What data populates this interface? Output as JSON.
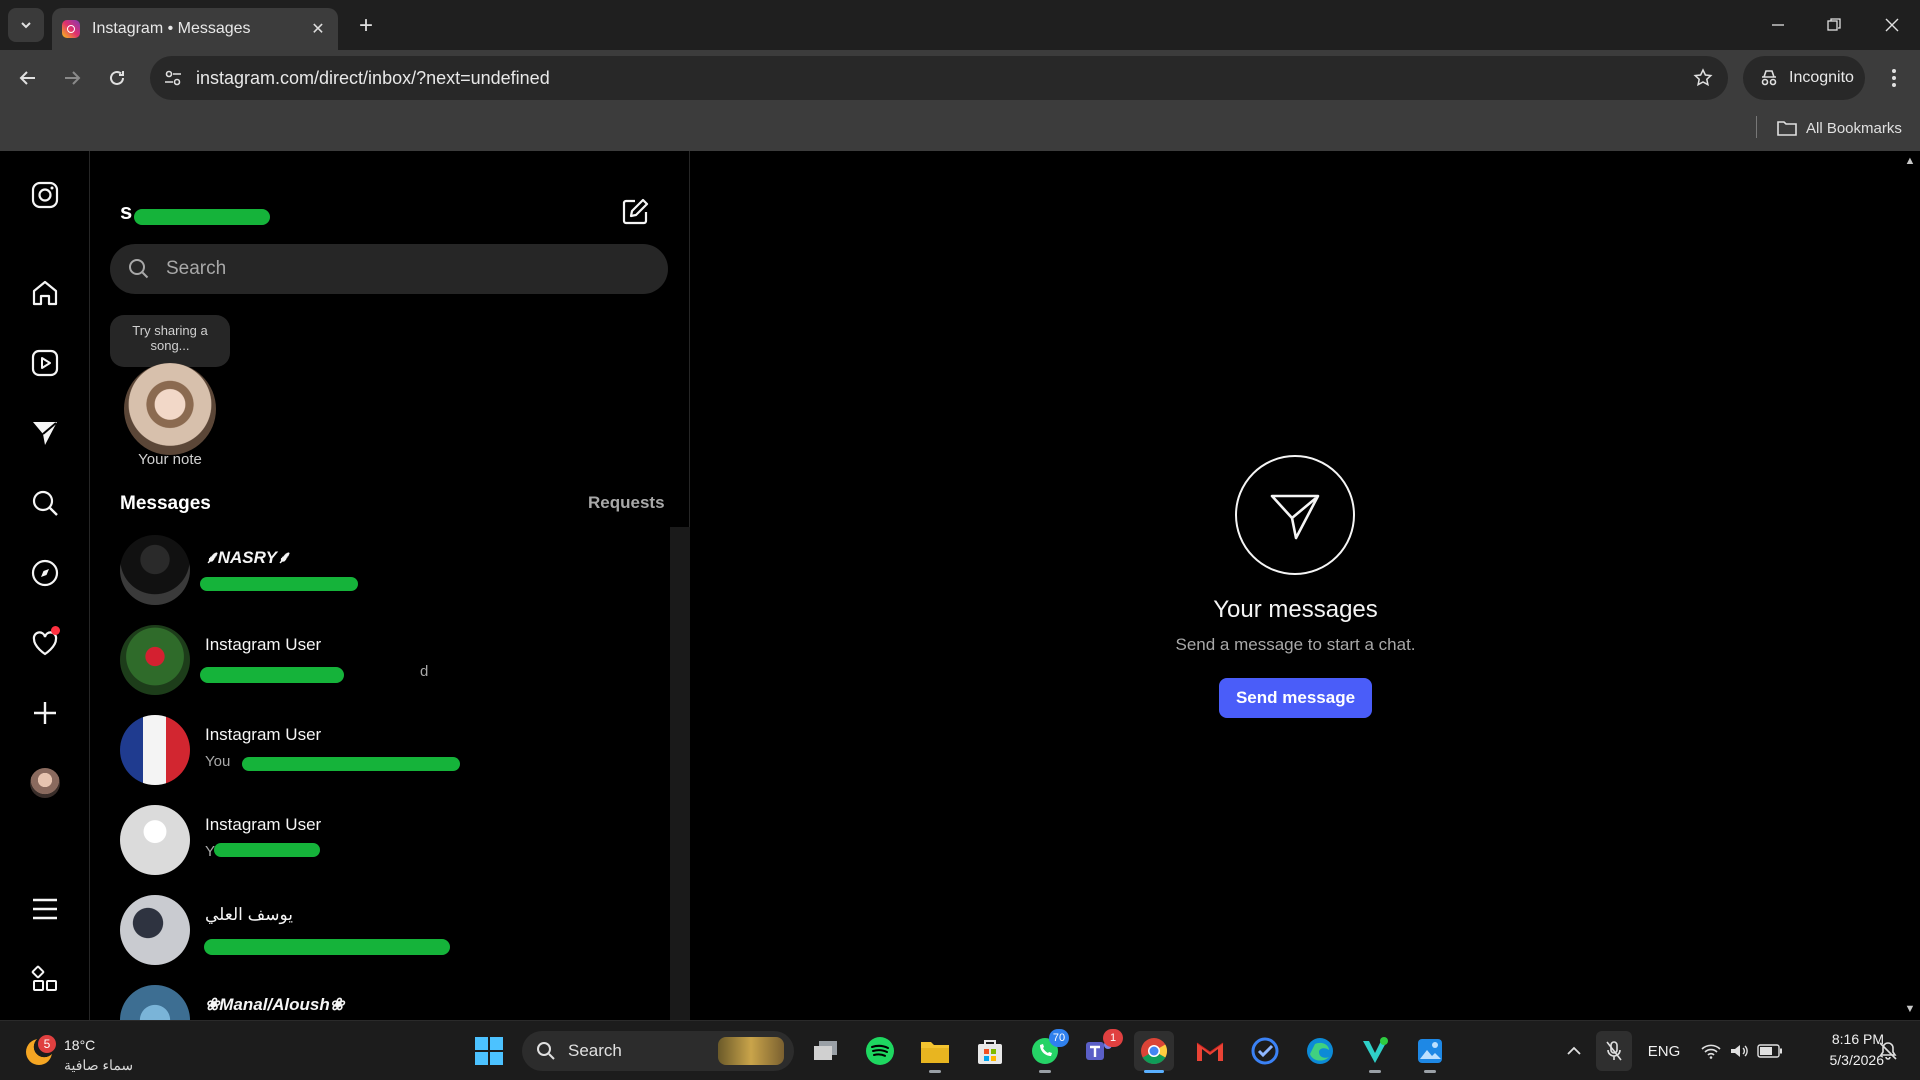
{
  "browser": {
    "tab_title": "Instagram • Messages",
    "url": "instagram.com/direct/inbox/?next=undefined",
    "incognito_label": "Incognito",
    "bookmarks_label": "All Bookmarks"
  },
  "sidebar": {
    "items": [
      "instagram-logo",
      "home",
      "reels",
      "messages",
      "search",
      "explore",
      "notifications",
      "create",
      "profile",
      "more",
      "also-from-meta"
    ]
  },
  "inbox": {
    "username": "s",
    "search_placeholder": "Search",
    "note_bubble": "Try sharing a song...",
    "note_label": "Your note",
    "messages_heading": "Messages",
    "requests_label": "Requests",
    "threads": [
      {
        "name": "⸙NASRY⸙",
        "preview": ""
      },
      {
        "name": "Instagram User",
        "preview": "d"
      },
      {
        "name": "Instagram User",
        "preview": "You"
      },
      {
        "name": "Instagram User",
        "preview": "Y"
      },
      {
        "name": "يوسف العلي",
        "preview": ""
      },
      {
        "name": "❀Manal/Aloush❀",
        "preview": ""
      }
    ]
  },
  "conversation": {
    "title": "Your messages",
    "subtitle": "Send a message to start a chat.",
    "button": "Send message"
  },
  "taskbar": {
    "weather_badge": "5",
    "temperature": "18°C",
    "condition": "سماء صافية",
    "search_label": "Search",
    "whatsapp_badge": "70",
    "teams_badge": "1",
    "language": "ENG",
    "time": "8:16 PM",
    "date": "5/3/2026"
  },
  "colors": {
    "accent": "#4a5df9",
    "notification_dot": "#ff3040",
    "redaction": "#15b33a"
  }
}
